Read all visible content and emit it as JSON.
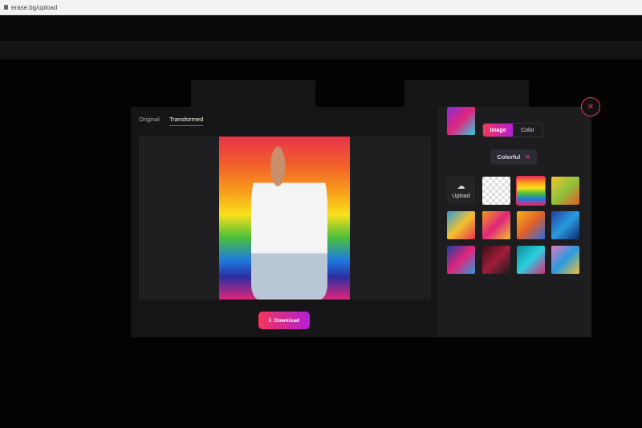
{
  "browser": {
    "url": "erase.bg/upload"
  },
  "modal": {
    "tabs": [
      {
        "label": "Original"
      },
      {
        "label": "Transformed"
      }
    ],
    "active_tab": "Transformed",
    "download_label": "Download",
    "background_type": {
      "options": [
        "Image",
        "Color"
      ],
      "selected": "Image"
    },
    "filter_chip": "Colorful",
    "upload_label": "Upload",
    "thumbnails": [
      "transparent",
      "rainbow",
      "yellow",
      "multi",
      "orange-pink",
      "orange",
      "blue",
      "red-blue",
      "dark-red",
      "teal",
      "pink-blue",
      "purple-pink"
    ],
    "selected_thumbnail": "rainbow"
  },
  "colors": {
    "accent": "#e8355f",
    "gradient_start": "#f5365c",
    "gradient_end": "#b21fd6"
  }
}
